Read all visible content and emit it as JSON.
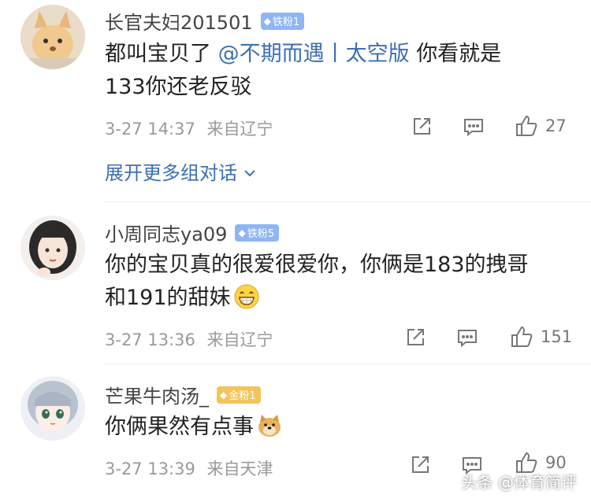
{
  "comments": [
    {
      "username": "长官夫妇201501",
      "badge": "铁粉1",
      "text_line1_prefix": "都叫宝贝了",
      "mention": "@不期而遇丨太空版",
      "text_line1_suffix": "你看就是",
      "text_line2": "133你还老反驳",
      "time": "3-27 14:37",
      "location": "来自辽宁",
      "likes": "27",
      "expand_label": "展开更多组对话"
    },
    {
      "username": "小周同志ya09",
      "badge": "铁粉5",
      "text_line1": "你的宝贝真的很爱很爱你，你俩是183的拽哥",
      "text_line2": "和191的甜妹",
      "emoji": "grin-emoji",
      "time": "3-27 13:36",
      "location": "来自辽宁",
      "likes": "151"
    },
    {
      "username": "芒果牛肉汤_",
      "badge": "金粉1",
      "text_line1": "你俩果然有点事",
      "emoji": "doge-emoji",
      "time": "3-27 13:39",
      "location": "来自天津",
      "likes": "90"
    }
  ],
  "watermark": "头条 @体育简评",
  "colors": {
    "link": "#3d6fb3",
    "badge_iron": "#8fb6f4",
    "badge_gold": "#f3c45a",
    "meta": "#9a9a9a"
  }
}
